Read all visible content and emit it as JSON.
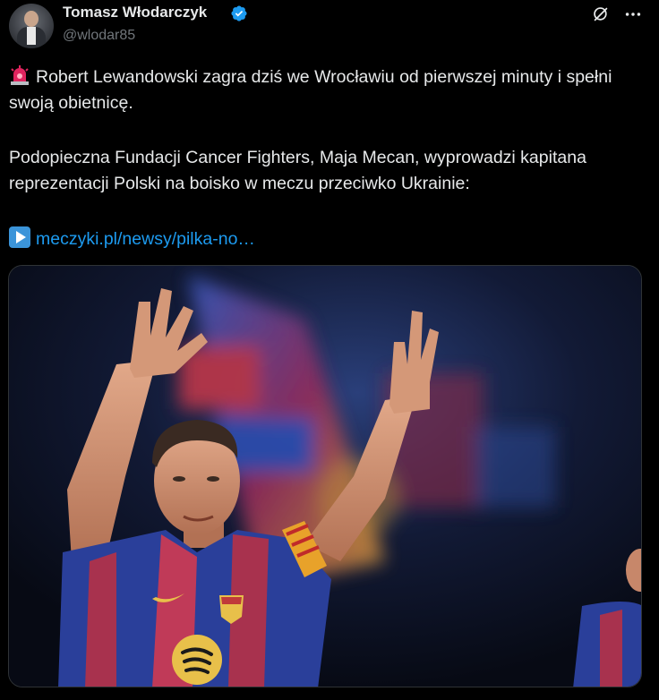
{
  "author": {
    "name": "Tomasz Włodarczyk",
    "handle": "@wlodar85",
    "verified_color": "#1d9bf0"
  },
  "tweet": {
    "line1": "Robert Lewandowski zagra dziś we Wrocławiu od pierwszej minuty i spełni swoją obietnicę.",
    "line2": "Podopieczna Fundacji Cancer Fighters, Maja Mecan, wyprowadzi kapitana reprezentacji Polski na boisko w meczu przeciwko Ukrainie:",
    "link": "meczyki.pl/newsy/pilka-no…",
    "emoji_1": "siren-icon",
    "emoji_2": "play-button-icon"
  },
  "media": {
    "type": "photo",
    "subject": "football-player-raising-hands"
  },
  "colors": {
    "background": "#000000",
    "text": "#e7e9ea",
    "secondary": "#71767b",
    "link": "#1d9bf0"
  }
}
